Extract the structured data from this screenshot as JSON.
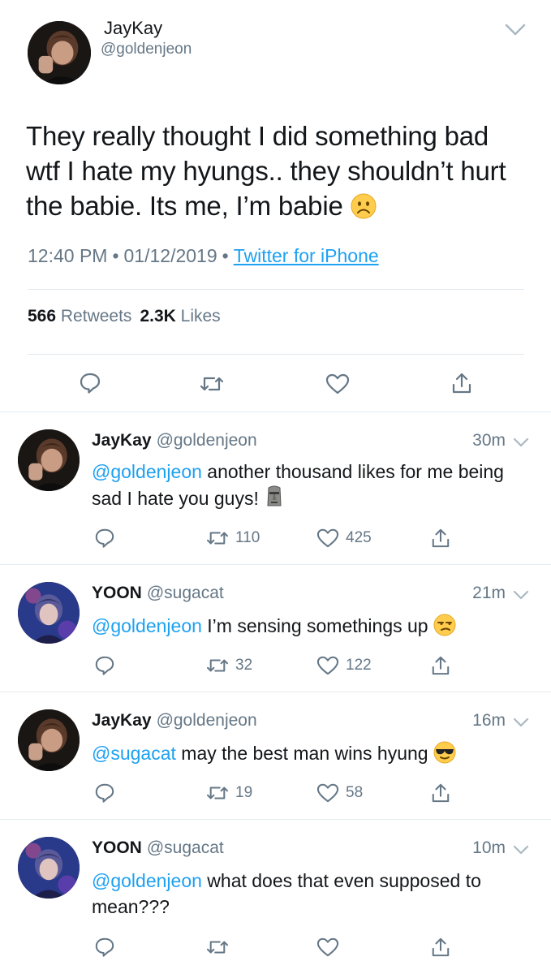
{
  "main": {
    "name": "JayKay",
    "handle": "@goldenjeon",
    "text": "They really thought I did something bad wtf I hate my hyungs.. they shouldn’t hurt the babie. Its me, I’m babie",
    "time": "12:40 PM",
    "date": "01/12/2019",
    "source": "Twitter for iPhone",
    "retweets_count": "566",
    "retweets_label": "Retweets",
    "likes_count": "2.3K",
    "likes_label": "Likes",
    "emoji": "frowning-face-emoji"
  },
  "replies": [
    {
      "name": "JayKay",
      "handle": "@goldenjeon",
      "time": "30m",
      "mention": "@goldenjeon",
      "text": "another thousand likes for me being sad I hate you guys!",
      "emoji": "moai-emoji",
      "retweets": "110",
      "likes": "425"
    },
    {
      "name": "YOON",
      "handle": "@sugacat",
      "time": "21m",
      "mention": "@goldenjeon",
      "text": "I’m sensing somethings up",
      "emoji": "unamused-face-emoji",
      "retweets": "32",
      "likes": "122"
    },
    {
      "name": "JayKay",
      "handle": "@goldenjeon",
      "time": "16m",
      "mention": "@sugacat",
      "text": "may the best man wins hyung",
      "emoji": "sunglasses-face-emoji",
      "retweets": "19",
      "likes": "58"
    },
    {
      "name": "YOON",
      "handle": "@sugacat",
      "time": "10m",
      "mention": "@goldenjeon",
      "text": "what does that even supposed to mean???",
      "emoji": "",
      "retweets": "",
      "likes": ""
    }
  ],
  "colors": {
    "link": "#1da1f2",
    "secondary_text": "#657786",
    "divider": "#e6ecf0"
  }
}
